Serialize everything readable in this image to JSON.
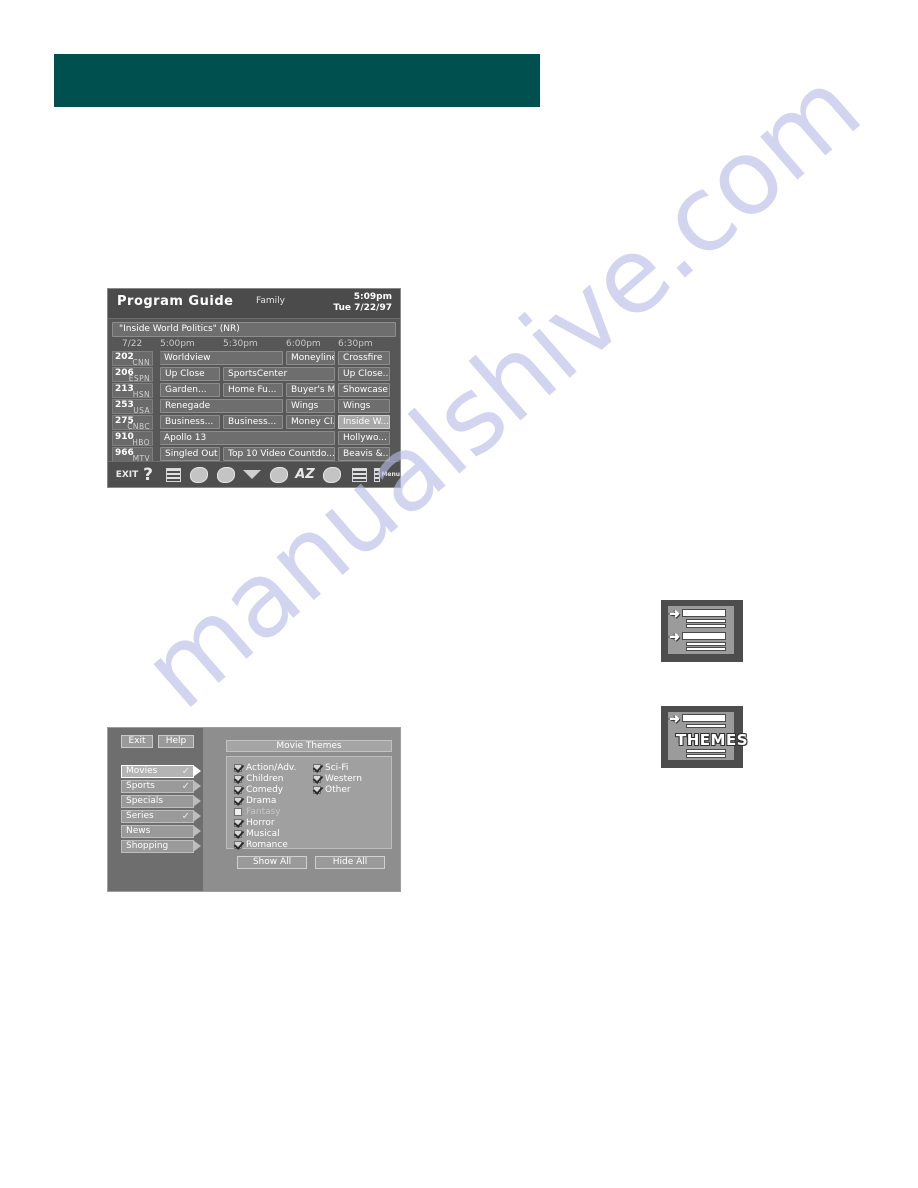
{
  "page": {
    "watermark": "manualshive.com",
    "teal_bar_color": "#00504f"
  },
  "program_guide": {
    "title": "Program Guide",
    "category": "Family",
    "time": "5:09pm",
    "date": "Tue 7/22/97",
    "now_playing": "\"Inside World Politics\" (NR)",
    "grid_date": "7/22",
    "time_slots": [
      "5:00pm",
      "5:30pm",
      "6:00pm",
      "6:30pm"
    ],
    "rows": [
      {
        "number": "202",
        "network": "CNN",
        "cells": [
          {
            "label": "Worldview",
            "start": 0,
            "span": 2,
            "continues_left": true,
            "selected": false
          },
          {
            "label": "Moneyline",
            "start": 2,
            "span": 1,
            "selected": false
          },
          {
            "label": "Crossfire",
            "start": 3,
            "span": 1,
            "selected": false
          }
        ]
      },
      {
        "number": "206",
        "network": "ESPN",
        "cells": [
          {
            "label": "Up Close",
            "start": 0,
            "span": 1,
            "selected": false
          },
          {
            "label": "SportsCenter",
            "start": 1,
            "span": 2,
            "selected": false
          },
          {
            "label": "Up Close...",
            "start": 3,
            "span": 1,
            "continues_right": true,
            "selected": false
          }
        ]
      },
      {
        "number": "213",
        "network": "HSN",
        "cells": [
          {
            "label": "Garden...",
            "start": 0,
            "span": 1,
            "selected": false
          },
          {
            "label": "Home Fu...",
            "start": 1,
            "span": 1,
            "selected": false
          },
          {
            "label": "Buyer's M...",
            "start": 2,
            "span": 1,
            "selected": false
          },
          {
            "label": "Showcase",
            "start": 3,
            "span": 1,
            "selected": false
          }
        ]
      },
      {
        "number": "253",
        "network": "USA",
        "cells": [
          {
            "label": "Renegade",
            "start": 0,
            "span": 2,
            "selected": false
          },
          {
            "label": "Wings",
            "start": 2,
            "span": 1,
            "selected": false
          },
          {
            "label": "Wings",
            "start": 3,
            "span": 1,
            "selected": false
          }
        ]
      },
      {
        "number": "275",
        "network": "CNBC",
        "cells": [
          {
            "label": "Business...",
            "start": 0,
            "span": 1,
            "selected": false
          },
          {
            "label": "Business...",
            "start": 1,
            "span": 1,
            "selected": false
          },
          {
            "label": "Money Cl...",
            "start": 2,
            "span": 1,
            "selected": false
          },
          {
            "label": "Inside W...",
            "start": 3,
            "span": 1,
            "selected": true
          }
        ]
      },
      {
        "number": "910",
        "network": "HBO",
        "cells": [
          {
            "label": "Apollo 13",
            "start": 0,
            "span": 3,
            "continues_left": true,
            "selected": false
          },
          {
            "label": "Hollywo...",
            "start": 3,
            "span": 1,
            "continues_right": true,
            "selected": false
          }
        ]
      },
      {
        "number": "966",
        "network": "MTV",
        "cells": [
          {
            "label": "Singled Out",
            "start": 0,
            "span": 1,
            "selected": false
          },
          {
            "label": "Top 10 Video Countdo...",
            "start": 1,
            "span": 2,
            "selected": false
          },
          {
            "label": "Beavis &...",
            "start": 3,
            "span": 1,
            "selected": false
          }
        ]
      }
    ],
    "toolbar": [
      {
        "icon": "exit-icon",
        "label": "EXIT"
      },
      {
        "icon": "help-question-icon",
        "label": "?"
      },
      {
        "icon": "listings-icon",
        "label": ""
      },
      {
        "icon": "sports-icon",
        "label": ""
      },
      {
        "icon": "kids-icon",
        "label": ""
      },
      {
        "icon": "down-triangle-icon",
        "label": ""
      },
      {
        "icon": "movies-icon",
        "label": ""
      },
      {
        "icon": "alphabetical-az-icon",
        "label": "AZ"
      },
      {
        "icon": "search-icon",
        "label": ""
      },
      {
        "icon": "schedule-icon",
        "label": ""
      },
      {
        "icon": "menu-icon",
        "label": "Menu"
      }
    ]
  },
  "themes_dialog": {
    "exit_label": "Exit",
    "help_label": "Help",
    "categories": [
      {
        "label": "Movies",
        "checked": true,
        "active": true
      },
      {
        "label": "Sports",
        "checked": true,
        "active": false
      },
      {
        "label": "Specials",
        "checked": false,
        "active": false
      },
      {
        "label": "Series",
        "checked": true,
        "active": false
      },
      {
        "label": "News",
        "checked": false,
        "active": false
      },
      {
        "label": "Shopping",
        "checked": false,
        "active": false
      }
    ],
    "panel_title": "Movie Themes",
    "themes_col1": [
      {
        "label": "Action/Adv.",
        "checked": true
      },
      {
        "label": "Children",
        "checked": true
      },
      {
        "label": "Comedy",
        "checked": true
      },
      {
        "label": "Drama",
        "checked": true
      },
      {
        "label": "Fantasy",
        "checked": false
      },
      {
        "label": "Horror",
        "checked": true
      },
      {
        "label": "Musical",
        "checked": true
      },
      {
        "label": "Romance",
        "checked": true
      }
    ],
    "themes_col2": [
      {
        "label": "Sci-Fi",
        "checked": true
      },
      {
        "label": "Western",
        "checked": true
      },
      {
        "label": "Other",
        "checked": true
      }
    ],
    "show_all_label": "Show All",
    "hide_all_label": "Hide All"
  },
  "icon_boxes": [
    {
      "name": "listings-icon-box",
      "caption": ""
    },
    {
      "name": "themes-icon-box",
      "caption": "THEMES"
    }
  ]
}
